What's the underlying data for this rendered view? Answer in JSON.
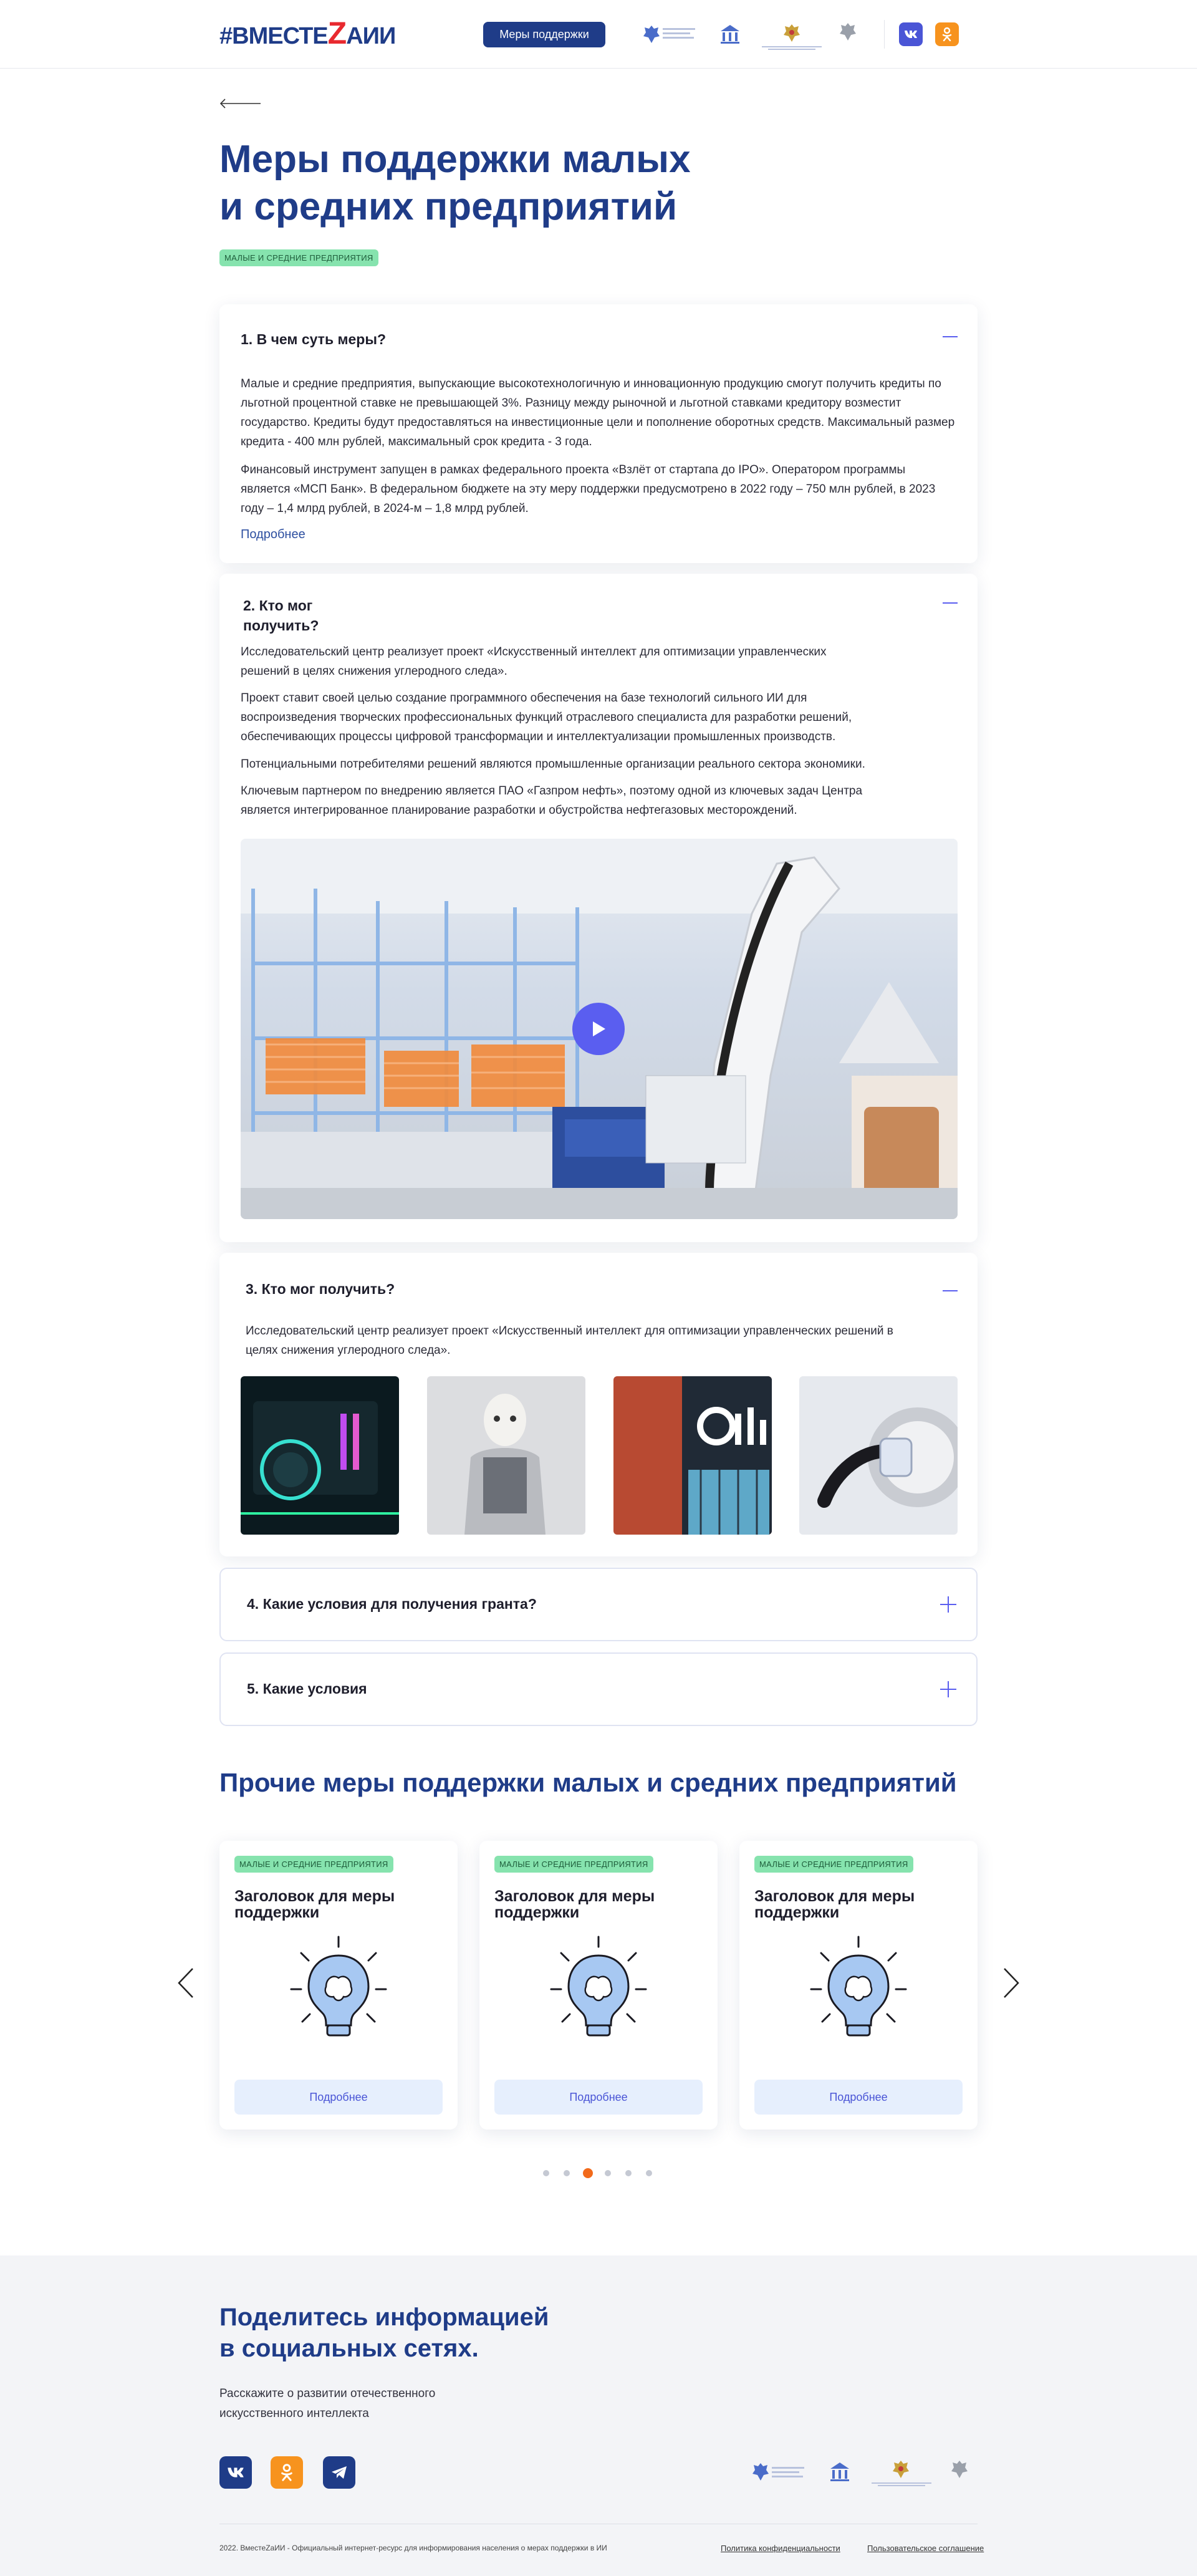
{
  "header": {
    "logo_prefix": "#ВМЕСТЕ",
    "logo_z": "Z",
    "logo_suffix": "АИИ",
    "nav_button": "Меры поддержки"
  },
  "page": {
    "title_line1": "Меры поддержки малых",
    "title_line2": "и средних предприятий",
    "tag": "МАЛЫЕ И СРЕДНИЕ ПРЕДПРИЯТИЯ"
  },
  "faq": [
    {
      "title": "1. В чем суть меры?",
      "p1": "Малые и средние предприятия, выпускающие высокотехнологичную и инновационную продукцию смогут получить кредиты по льготной процентной ставке не превышающей 3%. Разницу между рыночной и льготной ставками кредитору возместит государство. Кредиты будут предоставляться на инвестиционные цели и пополнение оборотных средств. Максимальный размер кредита - 400 млн рублей, максимальный срок кредита - 3 года.",
      "p2": "Финансовый инструмент запущен в рамках федерального проекта «Взлёт от стартапа до IPO». Оператором программы является «МСП Банк». В федеральном бюджете на эту меру поддержки предусмотрено в 2022 году – 750 млн рублей, в 2023 году – 1,4 млрд рублей, в 2024-м – 1,8 млрд рублей.",
      "more": "Подробнее"
    },
    {
      "title_line1": "2. Кто мог",
      "title_line2": "получить?",
      "p1": "Исследовательский центр реализует проект «Искусственный интеллект для оптимизации  управленческих решений в целях снижения углеродного следа».",
      "p2": "Проект ставит своей целью создание программного обеспечения на базе технологий сильного ИИ для воспроизведения творческих профессиональных функций отраслевого специалиста для разработки решений, обеспечивающих процессы цифровой трансформации и интеллектуализации промышленных производств.",
      "p3": "Потенциальными потребителями решений являются промышленные организации реального сектора экономики.",
      "p4": "Ключевым партнером по внедрению является ПАО «Газпром нефть», поэтому одной из ключевых задач Центра является интегрированное планирование разработки и обустройства нефтегазовых месторождений."
    },
    {
      "title": "3. Кто мог получить?",
      "p1": "Исследовательский центр реализует проект «Искусственный интеллект для оптимизации  управленческих решений в целях снижения углеродного следа»."
    },
    {
      "title": "4. Какие условия для получения гранта?"
    },
    {
      "title": "5. Какие условия"
    }
  ],
  "other": {
    "heading": "Прочие меры поддержки малых и средних предприятий",
    "cards": [
      {
        "tag": "МАЛЫЕ И СРЕДНИЕ ПРЕДПРИЯТИЯ",
        "title": "Заголовок для меры поддержки",
        "button": "Подробнее"
      },
      {
        "tag": "МАЛЫЕ И СРЕДНИЕ ПРЕДПРИЯТИЯ",
        "title": "Заголовок для меры поддержки",
        "button": "Подробнее"
      },
      {
        "tag": "МАЛЫЕ И СРЕДНИЕ ПРЕДПРИЯТИЯ",
        "title": "Заголовок для меры поддержки",
        "button": "Подробнее"
      }
    ],
    "dots": 6,
    "active_dot": 3
  },
  "footer": {
    "heading_line1": "Поделитесь информацией",
    "heading_line2": "в социальных сетях.",
    "text": "Расскажите о развитии отечественного искусственного интеллекта",
    "copyright": "2022. ВместеZаИИ - Официальный интернет-ресурс для информирования населения о мерах поддержки в ИИ",
    "privacy": "Политика конфиденциальности",
    "agreement": "Пользовательское соглашение"
  },
  "colors": {
    "brand": "#1f3c88",
    "accent": "#5a5ef0",
    "tag_bg": "#86e3ae",
    "vk": "#4a55d6",
    "ok": "#f7931e",
    "tg": "#1f3c88"
  }
}
